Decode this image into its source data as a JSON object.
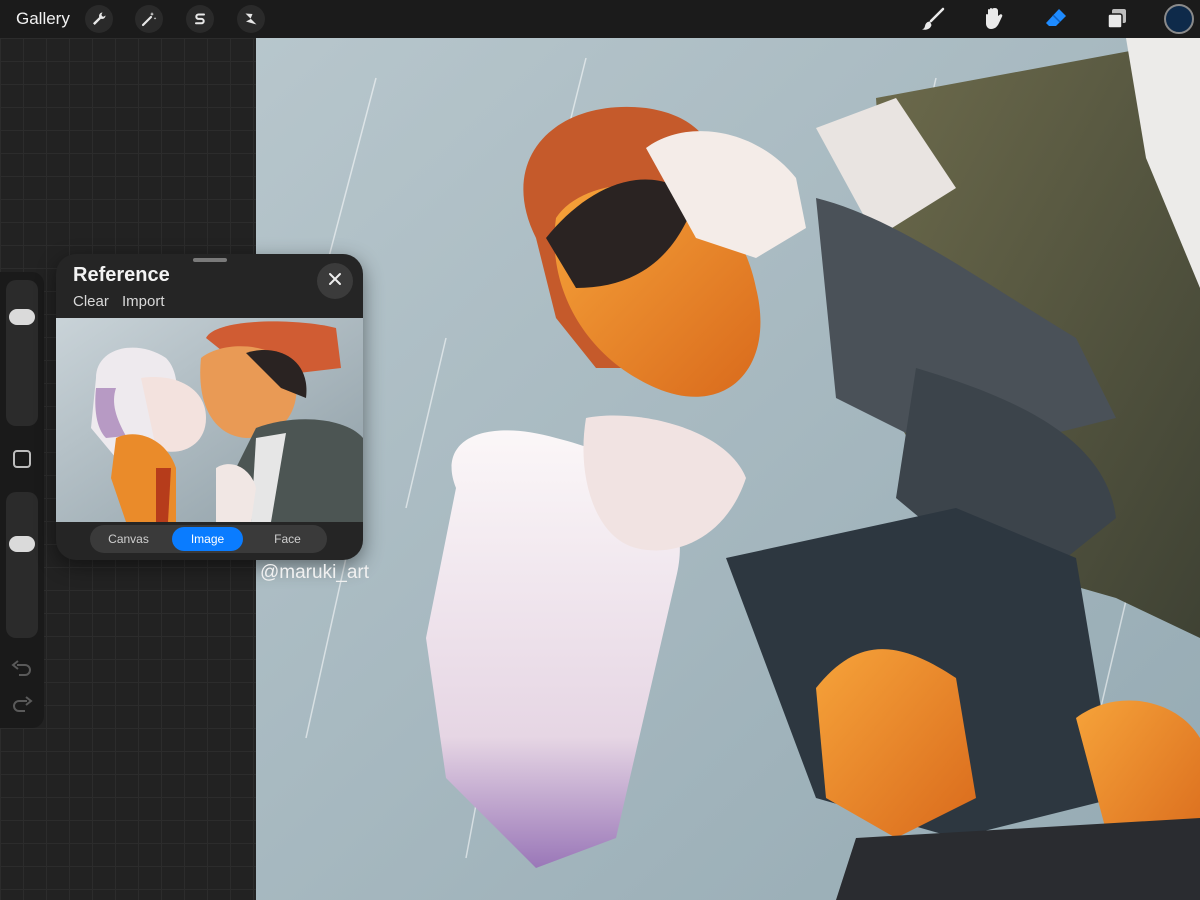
{
  "topbar": {
    "gallery_label": "Gallery",
    "left_tools": [
      {
        "icon": "wrench-icon",
        "name": "actions"
      },
      {
        "icon": "magic-wand-icon",
        "name": "adjustments"
      },
      {
        "icon": "selection-s-icon",
        "name": "selection"
      },
      {
        "icon": "arrow-cursor-icon",
        "name": "transform"
      }
    ],
    "right_tools": [
      {
        "icon": "brush-icon",
        "name": "paint"
      },
      {
        "icon": "smudge-icon",
        "name": "smudge"
      },
      {
        "icon": "eraser-icon",
        "name": "erase",
        "active": true
      },
      {
        "icon": "layers-icon",
        "name": "layers"
      }
    ],
    "current_color": "#0e2a4a",
    "active_tool_color": "#1e8bff"
  },
  "sidebar": {
    "brush_size_level": 0.22,
    "opacity_level": 0.34,
    "modify_icon": "square-icon",
    "undo_icon": "undo-icon",
    "redo_icon": "redo-icon"
  },
  "reference": {
    "title": "Reference",
    "clear_label": "Clear",
    "import_label": "Import",
    "close_icon": "close-icon",
    "modes": [
      {
        "label": "Canvas",
        "active": false
      },
      {
        "label": "Image",
        "active": true
      },
      {
        "label": "Face",
        "active": false
      }
    ],
    "accent": "#0a7cff"
  },
  "canvas": {
    "watermark": "@maruki_art"
  }
}
